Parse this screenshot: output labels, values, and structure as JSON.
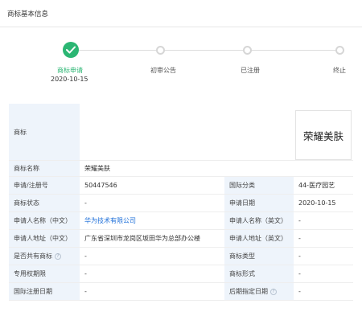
{
  "header": {
    "title": "商标基本信息"
  },
  "steps": [
    {
      "label": "商标申请",
      "date": "2020-10-15"
    },
    {
      "label": "初审公告"
    },
    {
      "label": "已注册"
    },
    {
      "label": "终止"
    }
  ],
  "colors": {
    "accent": "#2bb673",
    "label_bg": "#eef4fb",
    "link": "#1e6fd9"
  },
  "trademark": {
    "label": "商标",
    "image_text": "荣耀美肤"
  },
  "fields": {
    "name": {
      "label": "商标名称",
      "value": "荣耀美肤"
    },
    "reg_no": {
      "label": "申请/注册号",
      "value": "50447546"
    },
    "intl_class": {
      "label": "国际分类",
      "value": "44-医疗园艺"
    },
    "status": {
      "label": "商标状态",
      "value": "-"
    },
    "apply_date": {
      "label": "申请日期",
      "value": "2020-10-15"
    },
    "applicant_cn": {
      "label": "申请人名称（中文）",
      "value": "华为技术有限公司"
    },
    "applicant_en": {
      "label": "申请人名称（英文）",
      "value": "-"
    },
    "address_cn": {
      "label": "申请人地址（中文）",
      "value": "广东省深圳市龙岗区坂田华为总部办公楼"
    },
    "address_en": {
      "label": "申请人地址（英文）",
      "value": "-"
    },
    "shared": {
      "label": "是否共有商标",
      "value": "-"
    },
    "tm_type": {
      "label": "商标类型",
      "value": "-"
    },
    "exclusive_period": {
      "label": "专用权期限",
      "value": "-"
    },
    "tm_form": {
      "label": "商标形式",
      "value": "-"
    },
    "intl_reg_date": {
      "label": "国际注册日期",
      "value": "-"
    },
    "later_designation_date": {
      "label": "后期指定日期",
      "value": "-"
    }
  }
}
